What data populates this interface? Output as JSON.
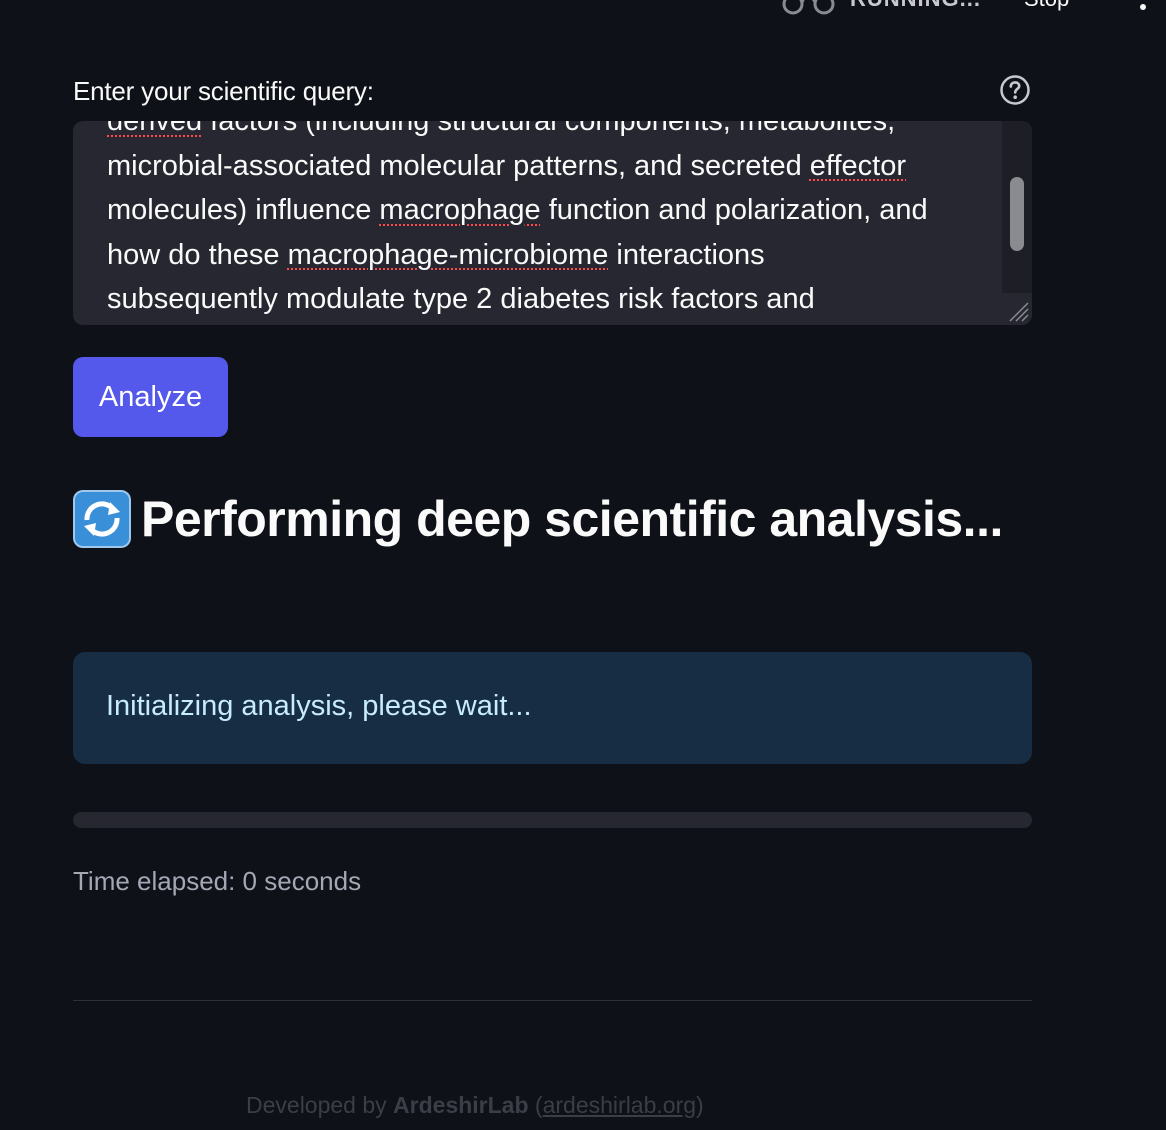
{
  "topbar": {
    "status_label": "RUNNING...",
    "stop_label": "Stop",
    "status_icon": "running-icon",
    "menu_icon": "more-vertical-icon"
  },
  "query": {
    "label": "Enter your scientific query:",
    "help_icon": "help-circle-icon",
    "lines": [
      "derived factors (including structural components, metabolites,",
      "microbial-associated molecular patterns, and secreted effector",
      "molecules) influence macrophage function and polarization, and",
      "how do these macrophage-microbiome interactions",
      "subsequently modulate type 2 diabetes risk factors and"
    ]
  },
  "analyze_button": {
    "label": "Analyze",
    "color": "#5459ec"
  },
  "status_heading": {
    "icon": "refresh-icon",
    "text": "Performing deep scientific analysis..."
  },
  "info": {
    "text": "Initializing analysis, please wait...",
    "bg_color": "#172d43",
    "text_color": "#c7ebff"
  },
  "progress": {
    "value": 0
  },
  "elapsed": {
    "text": "Time elapsed: 0 seconds"
  },
  "footer": {
    "prefix": "Developed by ",
    "lab_name": "ArdeshirLab",
    "paren_open": " (",
    "link_text": "ardeshirlab.org",
    "paren_close": ")"
  },
  "colors": {
    "background": "#0e1117",
    "surface": "#262730",
    "accent": "#5459ec",
    "spellcheck": "#ff4b4b"
  }
}
